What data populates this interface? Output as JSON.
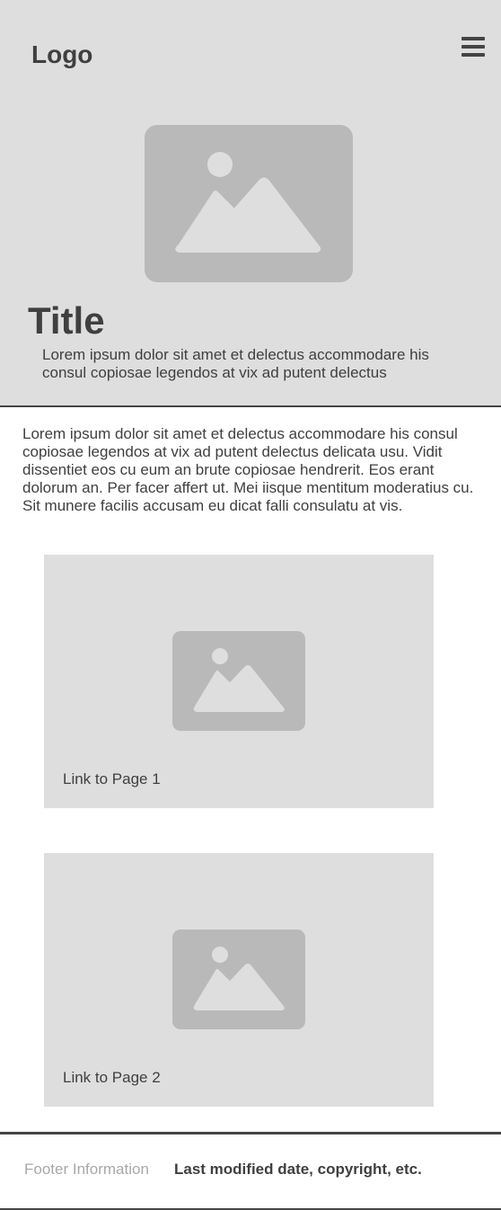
{
  "header": {
    "logo": "Logo",
    "menu_icon": "hamburger-menu-icon"
  },
  "hero": {
    "image_icon": "image-placeholder-icon",
    "title": "Title",
    "subtitle": "Lorem ipsum dolor sit amet et delectus accommodare his consul copiosae legendos at vix ad putent delectus"
  },
  "intro": {
    "text": "Lorem ipsum dolor sit amet et delectus accommodare his consul copiosae legendos at vix ad putent delectus delicata usu. Vidit dissentiet eos cu eum an brute copiosae hendrerit. Eos erant dolorum an. Per facer affert ut. Mei iisque mentitum moderatius cu. Sit munere facilis accusam eu dicat falli consulatu at vis."
  },
  "cards": [
    {
      "image_icon": "image-placeholder-icon",
      "link": "Link to Page 1"
    },
    {
      "image_icon": "image-placeholder-icon",
      "link": "Link to Page 2"
    }
  ],
  "footer": {
    "label": "Footer Information",
    "info": "Last modified date, copyright, etc."
  },
  "colors": {
    "panel_background": "#dedede",
    "placeholder": "#b9b9b9",
    "text": "#3f3f3f",
    "muted_text": "#a8a8a8",
    "divider": "#444444"
  }
}
